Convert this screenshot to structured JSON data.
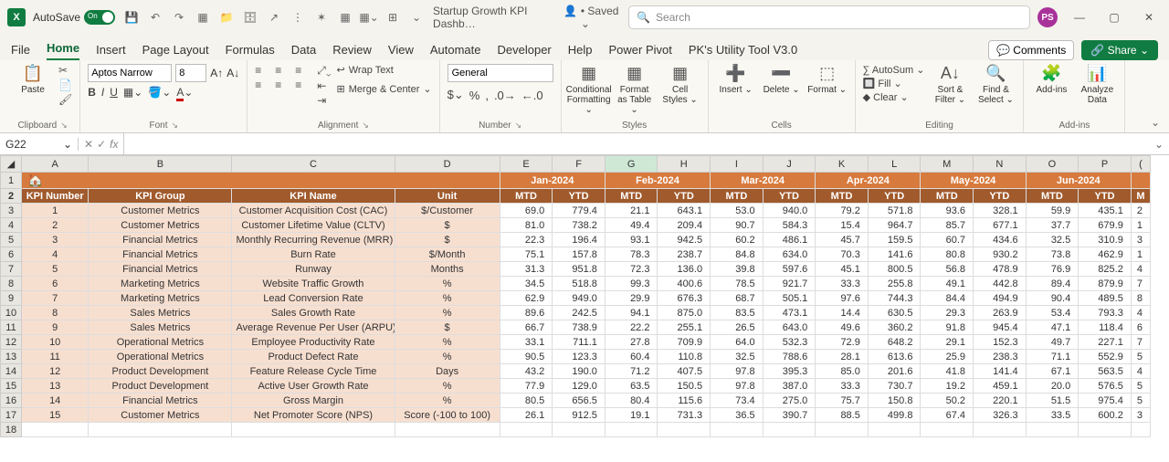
{
  "titlebar": {
    "autosave": "AutoSave",
    "autosaveState": "On",
    "docTitle": "Startup Growth KPI Dashb…",
    "savedStatus": "• Saved ⌄",
    "searchPlaceholder": "Search"
  },
  "avatar": "PS",
  "tabs": [
    "File",
    "Home",
    "Insert",
    "Page Layout",
    "Formulas",
    "Data",
    "Review",
    "View",
    "Automate",
    "Developer",
    "Help",
    "Power Pivot",
    "PK's Utility Tool V3.0"
  ],
  "activeTab": "Home",
  "commentsBtn": "💬 Comments",
  "shareBtn": "🔗 Share ⌄",
  "ribbon": {
    "paste": "Paste",
    "clipboard": "Clipboard",
    "fontName": "Aptos Narrow",
    "fontSize": "8",
    "fontGroup": "Font",
    "wrap": "Wrap Text",
    "merge": "Merge & Center",
    "alignment": "Alignment",
    "numberFormat": "General",
    "number": "Number",
    "cond": "Conditional Formatting ⌄",
    "fmtTable": "Format as Table ⌄",
    "cellStyles": "Cell Styles ⌄",
    "styles": "Styles",
    "insert": "Insert ⌄",
    "delete": "Delete ⌄",
    "format": "Format ⌄",
    "cells": "Cells",
    "autosum": "∑ AutoSum ⌄",
    "fill": "🔲 Fill ⌄",
    "clear": "◆ Clear ⌄",
    "sort": "Sort & Filter ⌄",
    "find": "Find & Select ⌄",
    "editing": "Editing",
    "addins": "Add-ins",
    "analyze": "Analyze Data"
  },
  "namebox": "G22",
  "colHeaders": [
    "A",
    "B",
    "C",
    "D",
    "E",
    "F",
    "G",
    "H",
    "I",
    "J",
    "K",
    "L",
    "M",
    "N",
    "O",
    "P"
  ],
  "months": [
    "Jan-2024",
    "Feb-2024",
    "Mar-2024",
    "Apr-2024",
    "May-2024",
    "Jun-2024"
  ],
  "tableHeaders": [
    "KPI Number",
    "KPI Group",
    "KPI Name",
    "Unit"
  ],
  "subHeaders": [
    "MTD",
    "YTD"
  ],
  "rows": [
    {
      "num": "1",
      "group": "Customer Metrics",
      "name": "Customer Acquisition Cost (CAC)",
      "unit": "$/Customer",
      "vals": [
        "69.0",
        "779.4",
        "21.1",
        "643.1",
        "53.0",
        "940.0",
        "79.2",
        "571.8",
        "93.6",
        "328.1",
        "59.9",
        "435.1"
      ],
      "extra": "2"
    },
    {
      "num": "2",
      "group": "Customer Metrics",
      "name": "Customer Lifetime Value (CLTV)",
      "unit": "$",
      "vals": [
        "81.0",
        "738.2",
        "49.4",
        "209.4",
        "90.7",
        "584.3",
        "15.4",
        "964.7",
        "85.7",
        "677.1",
        "37.7",
        "679.9"
      ],
      "extra": "1"
    },
    {
      "num": "3",
      "group": "Financial Metrics",
      "name": "Monthly Recurring Revenue (MRR)",
      "unit": "$",
      "vals": [
        "22.3",
        "196.4",
        "93.1",
        "942.5",
        "60.2",
        "486.1",
        "45.7",
        "159.5",
        "60.7",
        "434.6",
        "32.5",
        "310.9"
      ],
      "extra": "3"
    },
    {
      "num": "4",
      "group": "Financial Metrics",
      "name": "Burn Rate",
      "unit": "$/Month",
      "vals": [
        "75.1",
        "157.8",
        "78.3",
        "238.7",
        "84.8",
        "634.0",
        "70.3",
        "141.6",
        "80.8",
        "930.2",
        "73.8",
        "462.9"
      ],
      "extra": "1"
    },
    {
      "num": "5",
      "group": "Financial Metrics",
      "name": "Runway",
      "unit": "Months",
      "vals": [
        "31.3",
        "951.8",
        "72.3",
        "136.0",
        "39.8",
        "597.6",
        "45.1",
        "800.5",
        "56.8",
        "478.9",
        "76.9",
        "825.2"
      ],
      "extra": "4"
    },
    {
      "num": "6",
      "group": "Marketing Metrics",
      "name": "Website Traffic Growth",
      "unit": "%",
      "vals": [
        "34.5",
        "518.8",
        "99.3",
        "400.6",
        "78.5",
        "921.7",
        "33.3",
        "255.8",
        "49.1",
        "442.8",
        "89.4",
        "879.9"
      ],
      "extra": "7"
    },
    {
      "num": "7",
      "group": "Marketing Metrics",
      "name": "Lead Conversion Rate",
      "unit": "%",
      "vals": [
        "62.9",
        "949.0",
        "29.9",
        "676.3",
        "68.7",
        "505.1",
        "97.6",
        "744.3",
        "84.4",
        "494.9",
        "90.4",
        "489.5"
      ],
      "extra": "8"
    },
    {
      "num": "8",
      "group": "Sales Metrics",
      "name": "Sales Growth Rate",
      "unit": "%",
      "vals": [
        "89.6",
        "242.5",
        "94.1",
        "875.0",
        "83.5",
        "473.1",
        "14.4",
        "630.5",
        "29.3",
        "263.9",
        "53.4",
        "793.3"
      ],
      "extra": "4"
    },
    {
      "num": "9",
      "group": "Sales Metrics",
      "name": "Average Revenue Per User (ARPU)",
      "unit": "$",
      "vals": [
        "66.7",
        "738.9",
        "22.2",
        "255.1",
        "26.5",
        "643.0",
        "49.6",
        "360.2",
        "91.8",
        "945.4",
        "47.1",
        "118.4"
      ],
      "extra": "6"
    },
    {
      "num": "10",
      "group": "Operational Metrics",
      "name": "Employee Productivity Rate",
      "unit": "%",
      "vals": [
        "33.1",
        "711.1",
        "27.8",
        "709.9",
        "64.0",
        "532.3",
        "72.9",
        "648.2",
        "29.1",
        "152.3",
        "49.7",
        "227.1"
      ],
      "extra": "7"
    },
    {
      "num": "11",
      "group": "Operational Metrics",
      "name": "Product Defect Rate",
      "unit": "%",
      "vals": [
        "90.5",
        "123.3",
        "60.4",
        "110.8",
        "32.5",
        "788.6",
        "28.1",
        "613.6",
        "25.9",
        "238.3",
        "71.1",
        "552.9"
      ],
      "extra": "5"
    },
    {
      "num": "12",
      "group": "Product Development",
      "name": "Feature Release Cycle Time",
      "unit": "Days",
      "vals": [
        "43.2",
        "190.0",
        "71.2",
        "407.5",
        "97.8",
        "395.3",
        "85.0",
        "201.6",
        "41.8",
        "141.4",
        "67.1",
        "563.5"
      ],
      "extra": "4"
    },
    {
      "num": "13",
      "group": "Product Development",
      "name": "Active User Growth Rate",
      "unit": "%",
      "vals": [
        "77.9",
        "129.0",
        "63.5",
        "150.5",
        "97.8",
        "387.0",
        "33.3",
        "730.7",
        "19.2",
        "459.1",
        "20.0",
        "576.5"
      ],
      "extra": "5"
    },
    {
      "num": "14",
      "group": "Financial Metrics",
      "name": "Gross Margin",
      "unit": "%",
      "vals": [
        "80.5",
        "656.5",
        "80.4",
        "115.6",
        "73.4",
        "275.0",
        "75.7",
        "150.8",
        "50.2",
        "220.1",
        "51.5",
        "975.4"
      ],
      "extra": "5"
    },
    {
      "num": "15",
      "group": "Customer Metrics",
      "name": "Net Promoter Score (NPS)",
      "unit": "Score (-100 to 100)",
      "vals": [
        "26.1",
        "912.5",
        "19.1",
        "731.3",
        "36.5",
        "390.7",
        "88.5",
        "499.8",
        "67.4",
        "326.3",
        "33.5",
        "600.2"
      ],
      "extra": "3"
    }
  ],
  "partialCol": "M"
}
